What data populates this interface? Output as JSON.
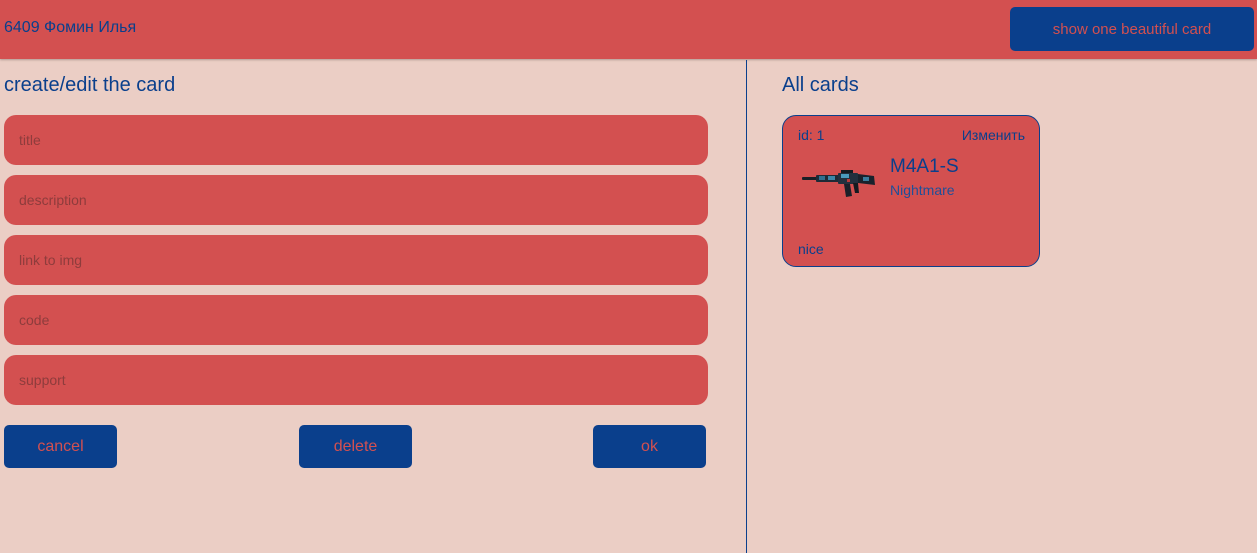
{
  "header": {
    "title": "6409 Фомин Илья",
    "show_card_label": "show one beautiful card"
  },
  "form": {
    "title": "create/edit the card",
    "fields": [
      {
        "placeholder": "title",
        "value": ""
      },
      {
        "placeholder": "description",
        "value": ""
      },
      {
        "placeholder": "link to img",
        "value": ""
      },
      {
        "placeholder": "code",
        "value": ""
      },
      {
        "placeholder": "support",
        "value": ""
      }
    ],
    "cancel_label": "cancel",
    "delete_label": "delete",
    "ok_label": "ok"
  },
  "cards": {
    "title": "All cards",
    "items": [
      {
        "id_text": "id: 1",
        "edit_label": "Изменить",
        "image": "rifle-image",
        "name": "M4A1-S",
        "description": "Nightmare",
        "comment": "nice"
      }
    ]
  },
  "colors": {
    "background": "#EBCEC5",
    "primary_red": "#D35050",
    "accent_blue": "#0A3F8C"
  }
}
